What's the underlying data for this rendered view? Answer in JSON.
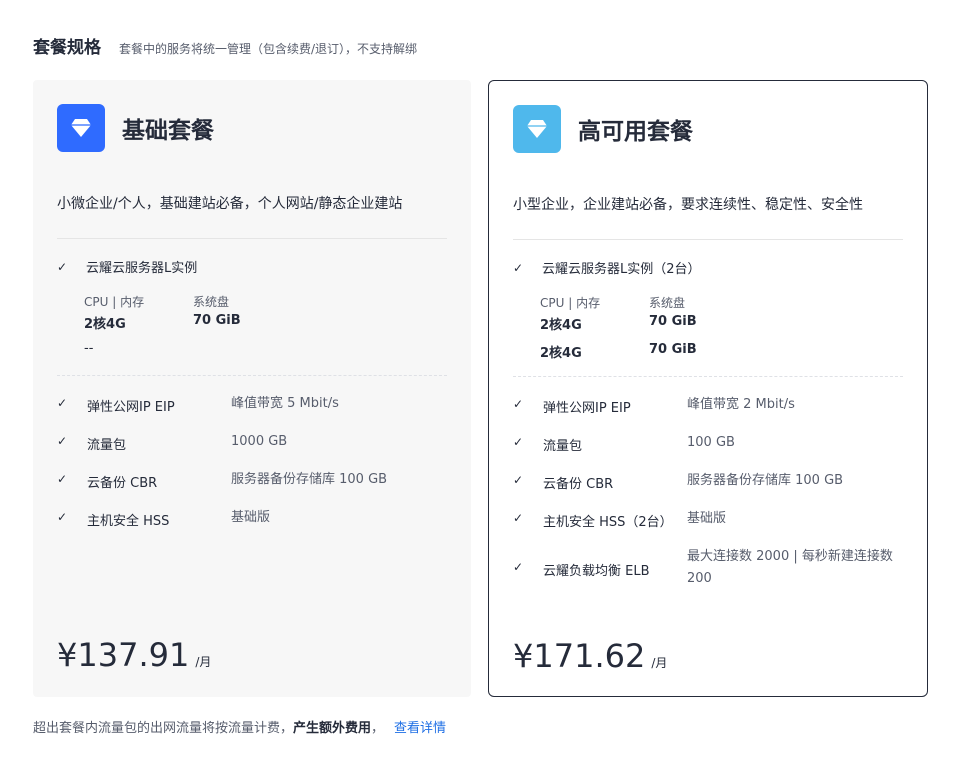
{
  "header": {
    "title": "套餐规格",
    "desc": "套餐中的服务将统一管理（包含续费/退订），不支持解绑"
  },
  "plans": [
    {
      "name": "基础套餐",
      "icon": "diamond-icon",
      "desc": "小微企业/个人，基础建站必备，个人网站/静态企业建站",
      "instance": "云耀云服务器L实例",
      "spec_headers": [
        "CPU | 内存",
        "系统盘"
      ],
      "spec_rows": [
        [
          "2核4G",
          "70 GiB"
        ]
      ],
      "spec_extra": "--",
      "features": [
        {
          "name": "弹性公网IP EIP",
          "value": "峰值带宽 5 Mbit/s"
        },
        {
          "name": "流量包",
          "value": "1000 GB"
        },
        {
          "name": "云备份 CBR",
          "value": "服务器备份存储库 100 GB"
        },
        {
          "name": "主机安全 HSS",
          "value": "基础版"
        }
      ],
      "price": "¥137.91",
      "unit": "/月",
      "selected": false
    },
    {
      "name": "高可用套餐",
      "icon": "diamond-icon",
      "desc": "小型企业，企业建站必备，要求连续性、稳定性、安全性",
      "instance": "云耀云服务器L实例（2台）",
      "spec_headers": [
        "CPU | 内存",
        "系统盘"
      ],
      "spec_rows": [
        [
          "2核4G",
          "70 GiB"
        ],
        [
          "2核4G",
          "70 GiB"
        ]
      ],
      "features": [
        {
          "name": "弹性公网IP EIP",
          "value": "峰值带宽 2 Mbit/s"
        },
        {
          "name": "流量包",
          "value": "100 GB"
        },
        {
          "name": "云备份 CBR",
          "value": "服务器备份存储库 100 GB"
        },
        {
          "name": "主机安全 HSS（2台）",
          "value": "基础版"
        },
        {
          "name": "云耀负载均衡 ELB",
          "value": "最大连接数 2000 | 每秒新建连接数 200"
        }
      ],
      "price": "¥171.62",
      "unit": "/月",
      "selected": true
    }
  ],
  "footer": {
    "text": "超出套餐内流量包的出网流量将按流量计费，",
    "strong": "产生额外费用",
    "comma": "，",
    "link": "查看详情"
  },
  "colors": {
    "basic_icon_bg": "#2f6bff",
    "ha_icon_bg": "#4fb8ec",
    "link": "#1f6fe5",
    "selected_border": "#252b3a"
  }
}
